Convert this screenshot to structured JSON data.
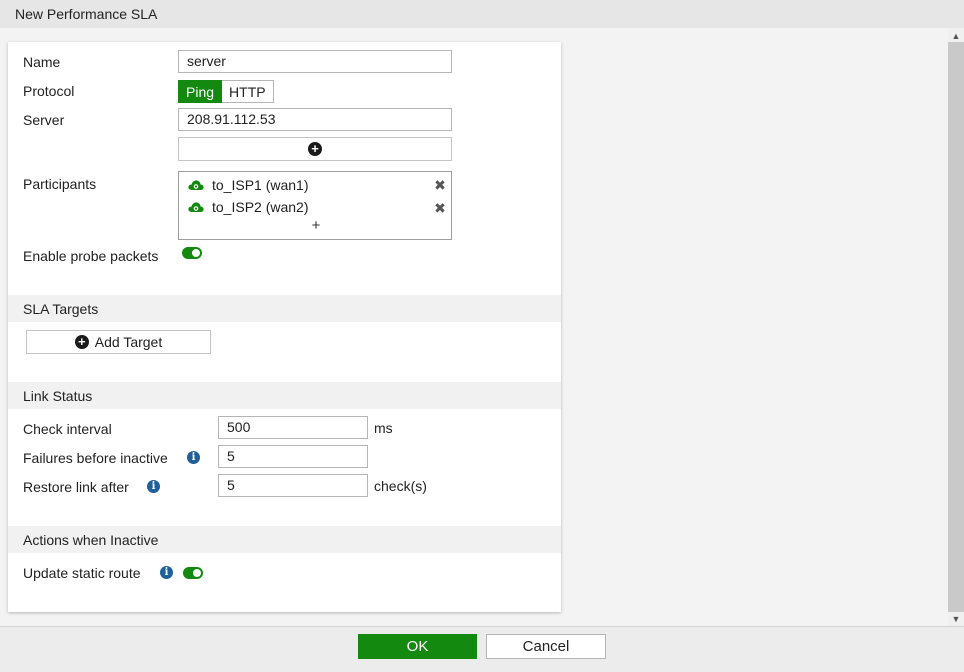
{
  "window": {
    "title": "New Performance SLA"
  },
  "form": {
    "name_label": "Name",
    "name_value": "server",
    "protocol_label": "Protocol",
    "protocol_options": [
      "Ping",
      "HTTP"
    ],
    "protocol_selected": "Ping",
    "server_label": "Server",
    "server_value": "208.91.112.53",
    "participants_label": "Participants",
    "participants": [
      {
        "name": "to_ISP1 (wan1)"
      },
      {
        "name": "to_ISP2 (wan2)"
      }
    ],
    "probe_label": "Enable probe packets",
    "probe_enabled": true
  },
  "sla_targets": {
    "heading": "SLA Targets",
    "add_label": "Add Target"
  },
  "link_status": {
    "heading": "Link Status",
    "check_interval_label": "Check interval",
    "check_interval_value": "500",
    "check_interval_unit": "ms",
    "failures_label": "Failures before inactive",
    "failures_value": "5",
    "restore_label": "Restore link after",
    "restore_value": "5",
    "restore_unit": "check(s)"
  },
  "actions": {
    "heading": "Actions when Inactive",
    "static_route_label": "Update static route",
    "static_route_enabled": true
  },
  "footer": {
    "ok_label": "OK",
    "cancel_label": "Cancel"
  },
  "colors": {
    "accent_green": "#13890f",
    "info_blue": "#1f5f9b"
  },
  "icons": [
    "plus-circle-icon",
    "cloud-icon",
    "close-icon",
    "plus-icon",
    "info-icon",
    "toggle-switch"
  ]
}
